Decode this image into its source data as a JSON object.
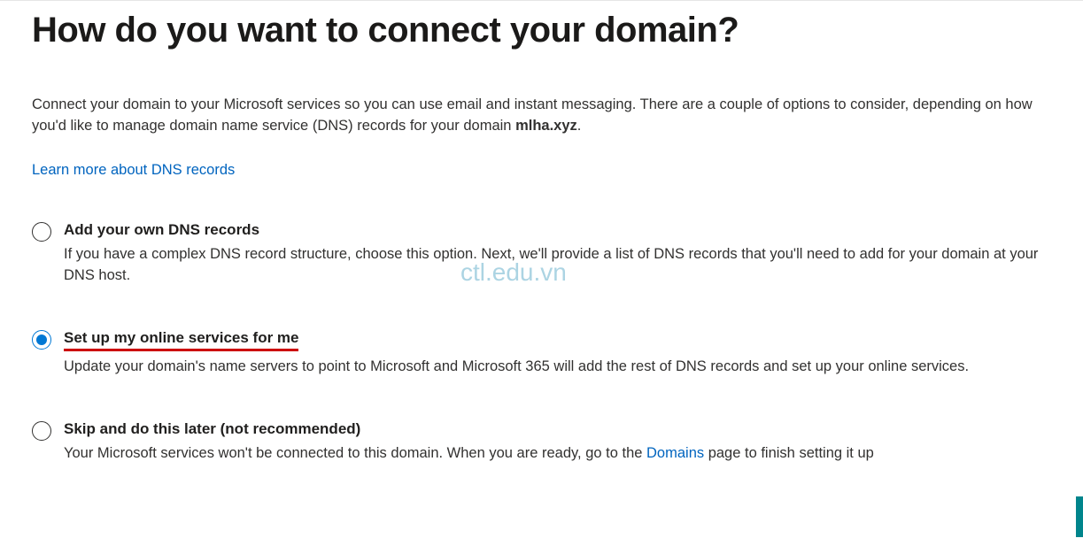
{
  "title": "How do you want to connect your domain?",
  "intro_prefix": "Connect your domain to your Microsoft services so you can use email and instant messaging. There are a couple of options to consider, depending on how you'd like to manage domain name service (DNS) records for your domain ",
  "domain_name": "mlha.xyz",
  "intro_suffix": ".",
  "learn_more": "Learn more about DNS records",
  "options": [
    {
      "title": "Add your own DNS records",
      "desc": "If you have a complex DNS record structure, choose this option. Next, we'll provide a list of DNS records that you'll need to add for your domain at your DNS host.",
      "selected": false
    },
    {
      "title": "Set up my online services for me",
      "desc": "Update your domain's name servers to point to Microsoft and Microsoft 365 will add the rest of DNS records and set up your online services.",
      "selected": true
    },
    {
      "title": "Skip and do this later (not recommended)",
      "desc_prefix": "Your Microsoft services won't be connected to this domain. When you are ready, go to the ",
      "desc_link": "Domains",
      "desc_suffix": " page to finish setting it up",
      "selected": false
    }
  ],
  "watermark": "ctl.edu.vn"
}
